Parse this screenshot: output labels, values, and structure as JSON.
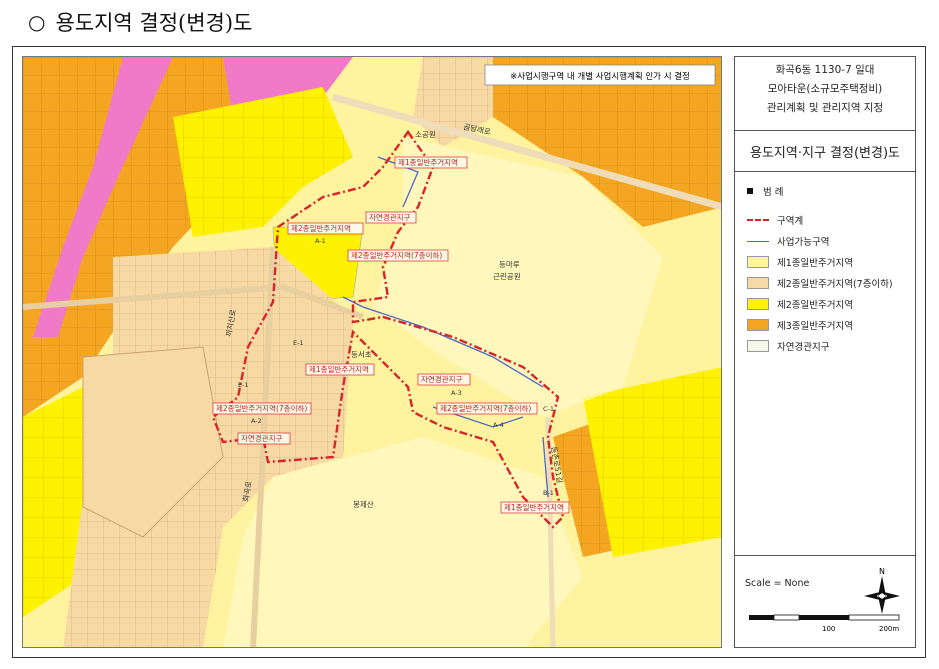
{
  "heading": {
    "bullet": "○",
    "text": "용도지역 결정(변경)도"
  },
  "map": {
    "note": "※사업시행구역 내 개별 사업시행계획 인가 시 결정",
    "labels": {
      "small_park": "소공원",
      "road": "곰달래로",
      "nature1": "자연경관지구",
      "zone1": "제1종일반주거지역",
      "zone2_a1": "제2종일반주거지역",
      "a1": "A-1",
      "zone2_7": "제2종일반주거지역(7층이하)",
      "park": "등마루",
      "park2": "근린공원",
      "road_vertical": "까치산로",
      "e1a": "E-1",
      "school": "등서초",
      "zone1b": "제1종일반주거지역",
      "e1b": "E-1",
      "zone2_7b": "제2종일반주거지역(7층이하)",
      "a2": "A-2",
      "nature2": "자연경관지구",
      "nature3": "자연경관지구",
      "a3": "A-3",
      "zone2_7c": "제2종일반주거지역(7층이하)",
      "a4": "A-4",
      "c1": "C-1",
      "road2": "화곡로",
      "road3": "등촌로51길",
      "mountain": "봉제산",
      "zone1c": "제1종일반주거지역",
      "b1": "B-1"
    }
  },
  "panel": {
    "title_lines": [
      "화곡6동 1130-7 일대",
      "모아타운(소규모주택정비)",
      "관리계획 및 관리지역 지정"
    ],
    "subtitle": "용도지역·지구 결정(변경)도",
    "legend_heading": "범  례",
    "legend": [
      {
        "label": "구역계",
        "kind": "boundary",
        "color": "#d7262b"
      },
      {
        "label": "사업가능구역",
        "kind": "project",
        "color": "#4a68c7"
      },
      {
        "label": "제1종일반주거지역",
        "kind": "fill",
        "color": "#fff3a0"
      },
      {
        "label": "제2종일반주거지역(7층이하)",
        "kind": "fill",
        "color": "#f7d9a4"
      },
      {
        "label": "제2종일반주거지역",
        "kind": "fill",
        "color": "#fff200"
      },
      {
        "label": "제3종일반주거지역",
        "kind": "fill",
        "color": "#f4a623"
      },
      {
        "label": "자연경관지구",
        "kind": "fill",
        "color": "#f5f7e8"
      }
    ],
    "scale_text": "Scale = None",
    "north_label": "N",
    "scale_labels": [
      "100",
      "200m"
    ]
  },
  "colors": {
    "zone1": "#fff3a0",
    "zone2_7": "#f7d9a4",
    "zone2": "#fff200",
    "zone3": "#f4a623",
    "commercial": "#f07ac8",
    "boundary": "#d7262b",
    "project": "#4a68c7"
  }
}
